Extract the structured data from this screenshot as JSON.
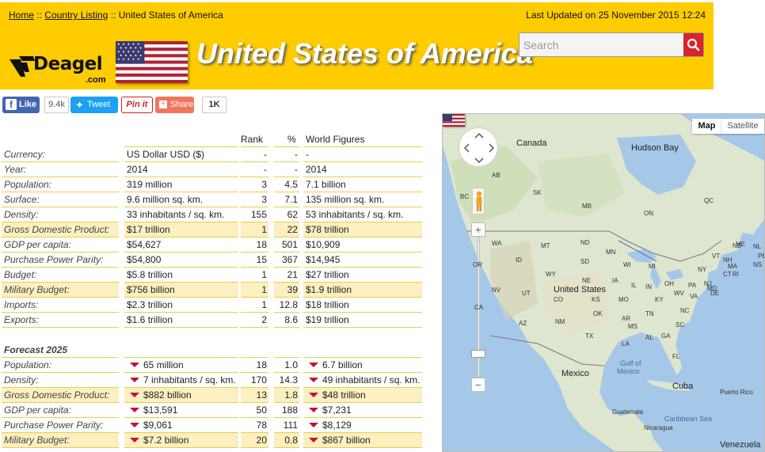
{
  "breadcrumb": {
    "home": "Home",
    "sep1": " :: ",
    "listing": "Country Listing",
    "sep2": " :: ",
    "current": "United States of America"
  },
  "last_updated": "Last Updated on 25 November 2015 12:24",
  "logo": {
    "text": "Deagel",
    "sub": ".com"
  },
  "title": "United States of America",
  "search": {
    "placeholder": "Search",
    "value": ""
  },
  "social": {
    "like_label": "Like",
    "like_count": "9.4k",
    "tweet_label": "Tweet",
    "pin_label": "Pin it",
    "share_label": "Share",
    "share_count": "1K"
  },
  "table": {
    "headers": {
      "rank": "Rank",
      "pct": "%",
      "world": "World Figures"
    },
    "rows": [
      {
        "label": "Currency:",
        "value": "US Dollar USD ($)",
        "rank": "-",
        "pct": "-",
        "world": "-",
        "hl": false
      },
      {
        "label": "Year:",
        "value": "2014",
        "rank": "-",
        "pct": "-",
        "world": "2014",
        "hl": false
      },
      {
        "label": "Population:",
        "value": "319 million",
        "rank": "3",
        "pct": "4.5",
        "world": "7.1 billion",
        "hl": false
      },
      {
        "label": "Surface:",
        "value": "9.6 million sq. km.",
        "rank": "3",
        "pct": "7.1",
        "world": "135 million sq. km.",
        "hl": false
      },
      {
        "label": "Density:",
        "value": "33 inhabitants / sq. km.",
        "rank": "155",
        "pct": "62",
        "world": "53 inhabitants / sq. km.",
        "hl": false
      },
      {
        "label": "Gross Domestic Product:",
        "value": "$17 trillion",
        "rank": "1",
        "pct": "22",
        "world": "$78 trillion",
        "hl": true
      },
      {
        "label": "GDP per capita:",
        "value": "$54,627",
        "rank": "18",
        "pct": "501",
        "world": "$10,909",
        "hl": false
      },
      {
        "label": "Purchase Power Parity:",
        "value": "$54,800",
        "rank": "15",
        "pct": "367",
        "world": "$14,945",
        "hl": false
      },
      {
        "label": "Budget:",
        "value": "$5.8 trillion",
        "rank": "1",
        "pct": "21",
        "world": "$27 trillion",
        "hl": false
      },
      {
        "label": "Military Budget:",
        "value": "$756 billion",
        "rank": "1",
        "pct": "39",
        "world": "$1.9 trillion",
        "hl": true
      },
      {
        "label": "Imports:",
        "value": "$2.3 trillion",
        "rank": "1",
        "pct": "12.8",
        "world": "$18 trillion",
        "hl": false
      },
      {
        "label": "Exports:",
        "value": "$1.6 trillion",
        "rank": "2",
        "pct": "8.6",
        "world": "$19 trillion",
        "hl": false
      }
    ],
    "forecast_title": "Forecast 2025",
    "forecast_rows": [
      {
        "label": "Population:",
        "value": "65 million",
        "rank": "18",
        "pct": "1.0",
        "world": "6.7 billion",
        "hl": false
      },
      {
        "label": "Density:",
        "value": "7 inhabitants / sq. km.",
        "rank": "170",
        "pct": "14.3",
        "world": "49 inhabitants / sq. km.",
        "hl": false
      },
      {
        "label": "Gross Domestic Product:",
        "value": "$882 billion",
        "rank": "13",
        "pct": "1.8",
        "world": "$48 trillion",
        "hl": true
      },
      {
        "label": "GDP per capita:",
        "value": "$13,591",
        "rank": "50",
        "pct": "188",
        "world": "$7,231",
        "hl": false
      },
      {
        "label": "Purchase Power Parity:",
        "value": "$9,061",
        "rank": "78",
        "pct": "111",
        "world": "$8,129",
        "hl": false
      },
      {
        "label": "Military Budget:",
        "value": "$7.2 billion",
        "rank": "20",
        "pct": "0.8",
        "world": "$867 billion",
        "hl": true
      }
    ]
  },
  "map": {
    "type_map": "Map",
    "type_satellite": "Satellite",
    "zoom_in": "+",
    "zoom_out": "−",
    "labels": {
      "canada": "Canada",
      "hudson": "Hudson Bay",
      "us": "United States",
      "mexico": "Mexico",
      "gulf1": "Gulf of",
      "gulf2": "Mexico",
      "cuba": "Cuba",
      "pr": "Puerto Rico",
      "carib": "Caribbean Sea",
      "guat": "Guatemala",
      "nic": "Nicaragua",
      "ven": "Venezuela",
      "ab": "AB",
      "sk": "SK",
      "mb": "MB",
      "on": "ON",
      "qc": "QC",
      "nl": "NL",
      "nb": "NB",
      "pe": "PE",
      "ns": "NS",
      "bc": "BC",
      "wa": "WA",
      "mt": "MT",
      "nd": "ND",
      "mn": "MN",
      "id": "ID",
      "sd": "SD",
      "wi": "WI",
      "mi": "MI",
      "vt": "VT",
      "nh": "NH",
      "me": "ME",
      "or": "OR",
      "wy": "WY",
      "ne": "NE",
      "ia": "IA",
      "il": "IL",
      "in": "IN",
      "oh": "OH",
      "ny": "NY",
      "pa": "PA",
      "ma": "MA",
      "ri": "RI",
      "nv": "NV",
      "ut": "UT",
      "co": "CO",
      "ks": "KS",
      "mo": "MO",
      "ky": "KY",
      "wv": "WV",
      "va": "VA",
      "nj": "NJ",
      "ct": "CT",
      "de": "DE",
      "md": "MD",
      "ca": "CA",
      "az": "AZ",
      "nm": "NM",
      "ok": "OK",
      "ar": "AR",
      "tn": "TN",
      "nc": "NC",
      "sc": "SC",
      "ga": "GA",
      "al": "AL",
      "ms": "MS",
      "la": "LA",
      "tx": "TX",
      "fl": "FL"
    }
  },
  "colors": {
    "banner": "#ffcc00",
    "accent_red": "#d6262b",
    "row_highlight": "#fcefc0",
    "row_border": "#e8cf45"
  }
}
